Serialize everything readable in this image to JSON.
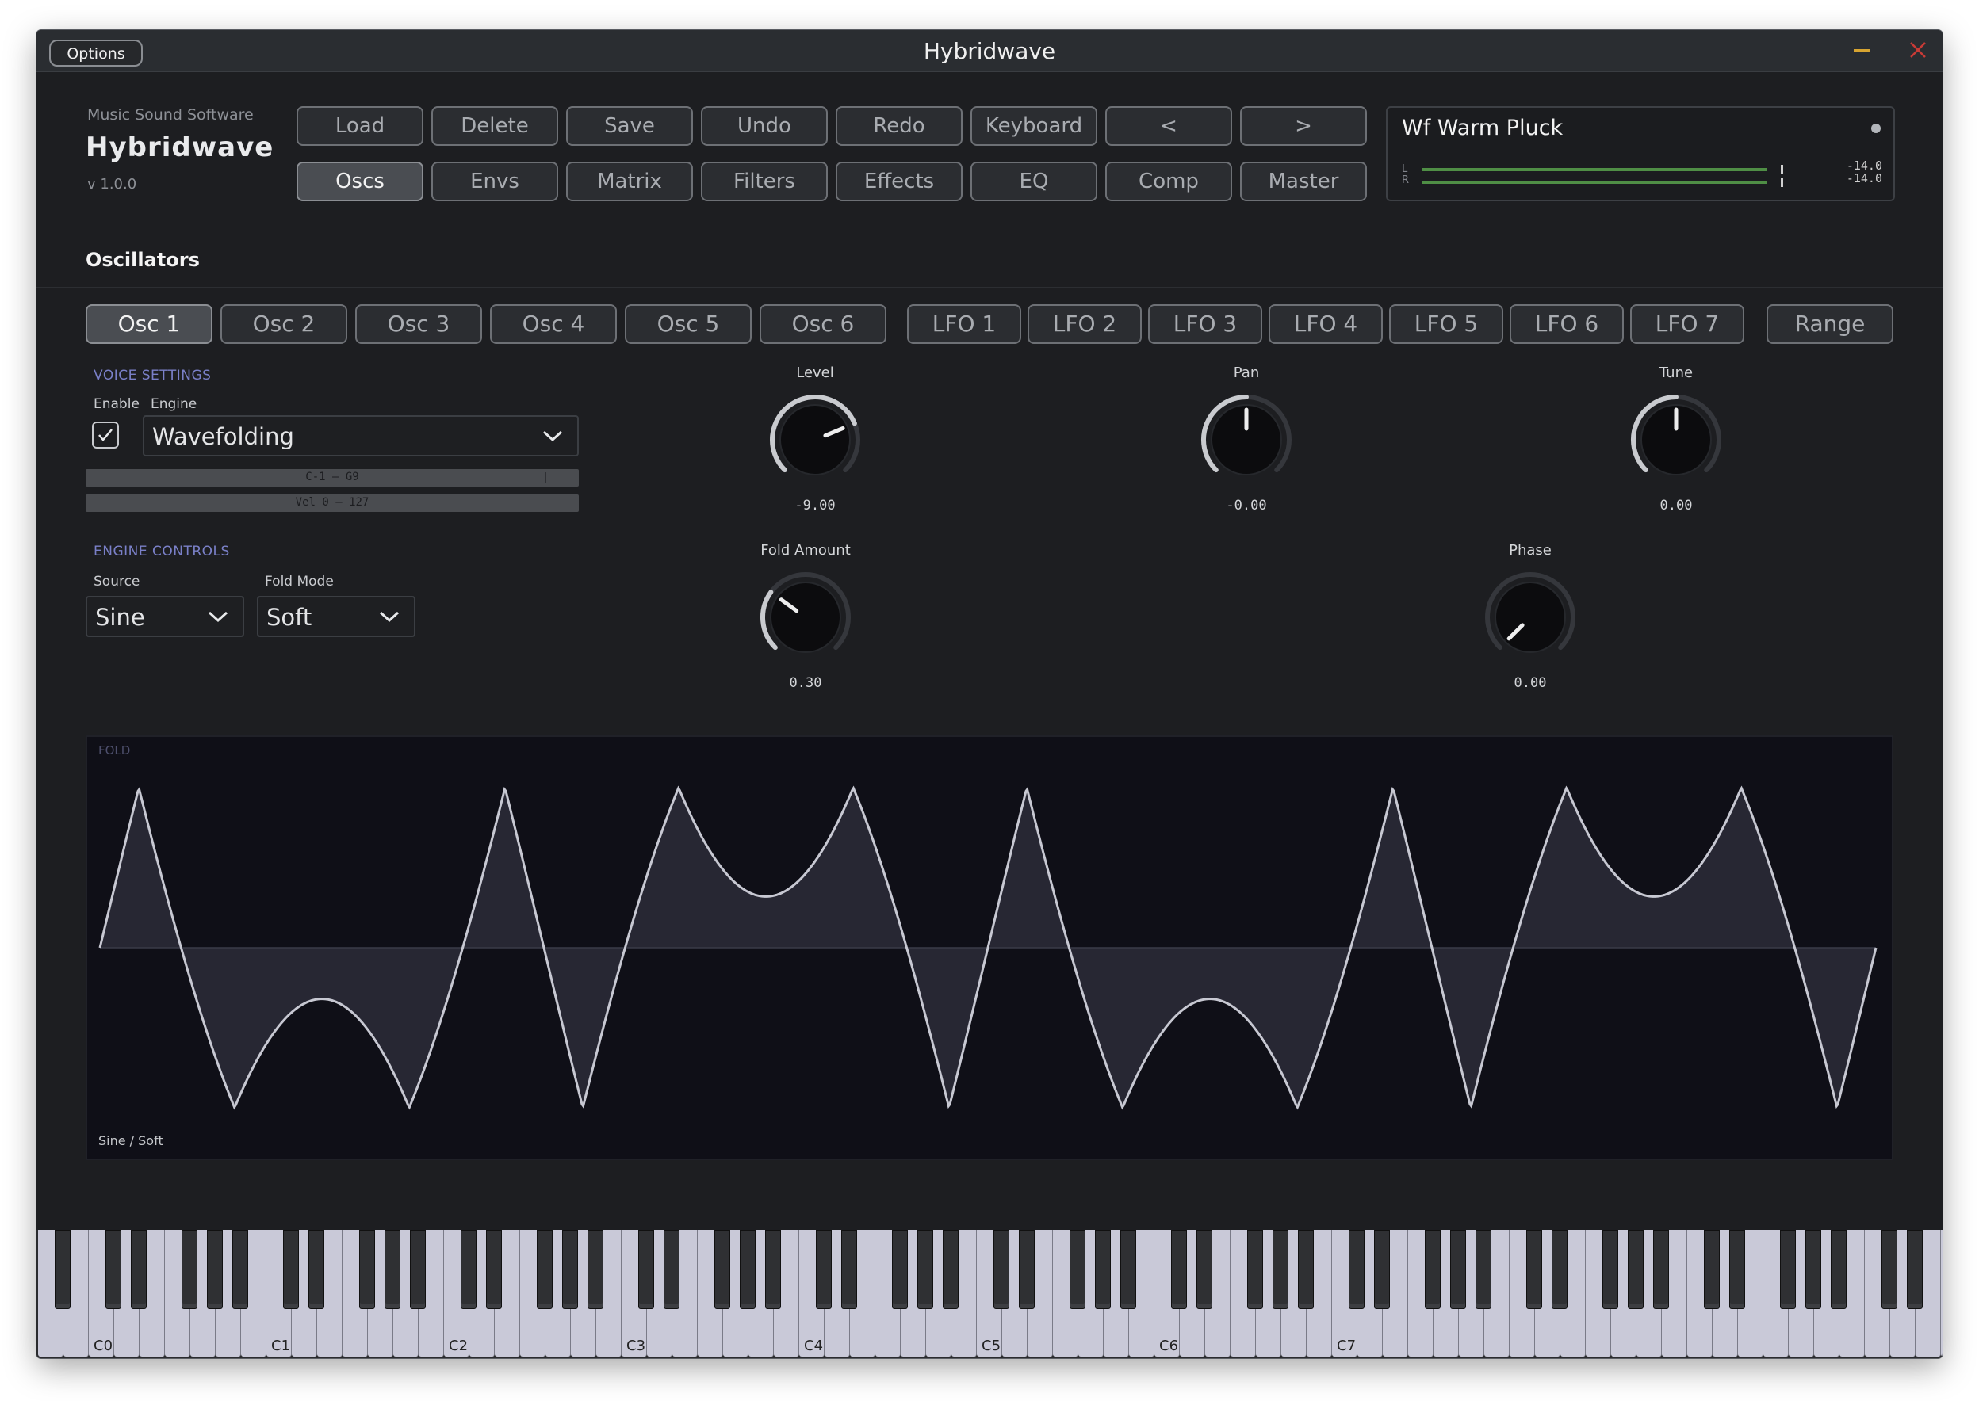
{
  "window": {
    "title": "Hybridwave",
    "options_label": "Options"
  },
  "brand": {
    "company": "Music Sound Software",
    "name": "Hybridwave",
    "version": "v 1.0.0"
  },
  "toolbar": {
    "row1": [
      "Load",
      "Delete",
      "Save",
      "Undo",
      "Redo",
      "Keyboard",
      "<",
      ">"
    ],
    "row2": [
      "Oscs",
      "Envs",
      "Matrix",
      "Filters",
      "Effects",
      "EQ",
      "Comp",
      "Master"
    ],
    "active_row2": "Oscs"
  },
  "preset": {
    "name": "Wf Warm Pluck",
    "meter": {
      "left_label": "L",
      "right_label": "R",
      "left_value": "-14.0",
      "right_value": "-14.0"
    }
  },
  "section": {
    "title": "Oscillators"
  },
  "tabs": {
    "osc": [
      "Osc 1",
      "Osc 2",
      "Osc 3",
      "Osc 4",
      "Osc 5",
      "Osc 6"
    ],
    "lfo": [
      "LFO 1",
      "LFO 2",
      "LFO 3",
      "LFO 4",
      "LFO 5",
      "LFO 6",
      "LFO 7"
    ],
    "range": "Range",
    "active": "Osc 1"
  },
  "voice": {
    "heading": "VOICE SETTINGS",
    "enable_label": "Enable",
    "engine_label": "Engine",
    "enabled": true,
    "engine_value": "Wavefolding",
    "key_range": "C-1 – G9",
    "vel_range": "Vel 0 – 127"
  },
  "engine_controls": {
    "heading": "ENGINE CONTROLS",
    "source_label": "Source",
    "source_value": "Sine",
    "fold_mode_label": "Fold Mode",
    "fold_mode_value": "Soft"
  },
  "knobs": {
    "level": {
      "label": "Level",
      "value": "-9.00",
      "norm": 0.75
    },
    "pan": {
      "label": "Pan",
      "value": "-0.00",
      "norm": 0.5
    },
    "tune": {
      "label": "Tune",
      "value": "0.00",
      "norm": 0.5
    },
    "fold_amount": {
      "label": "Fold Amount",
      "value": "0.30",
      "norm": 0.3
    },
    "phase": {
      "label": "Phase",
      "value": "0.00",
      "norm": 0.0
    }
  },
  "waveform": {
    "tag": "FOLD",
    "caption": "Sine / Soft",
    "cycles": 2,
    "fold_amount": 0.3
  },
  "keyboard": {
    "octave_labels": [
      "C0",
      "C1",
      "C2",
      "C3",
      "C4",
      "C5",
      "C6",
      "C7"
    ]
  },
  "colors": {
    "accent": "#7a80c8",
    "meter_green": "#4f8e45",
    "close_red": "#c83b36",
    "minimize_amber": "#d7a431"
  }
}
